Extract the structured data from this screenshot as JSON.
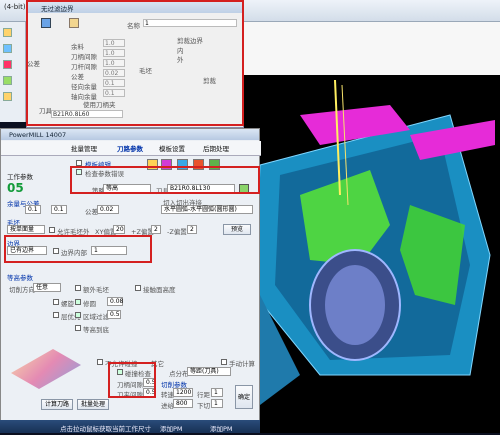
{
  "topbar": {
    "title": "(4-bit)"
  },
  "dialog_top": {
    "title": "无过滤边界",
    "name_label": "名称",
    "name_value": "1",
    "clip_label": "剪裁边界",
    "radio_inside": "内",
    "radio_outside": "外",
    "shape_label": "毛坯",
    "group_label": "公差",
    "fields": [
      {
        "label": "余料",
        "value": "1.0"
      },
      {
        "label": "刀柄间隙",
        "value": "1.0"
      },
      {
        "label": "刀杆间隙",
        "value": "1.0"
      },
      {
        "label": "公差",
        "value": "0.02"
      },
      {
        "label": "径向余量",
        "value": "0.1"
      },
      {
        "label": "轴向余量",
        "value": "0.1"
      }
    ],
    "use_holder": "使用刀柄夹",
    "tool_label": "刀具",
    "tool_value": "B21R0.8L60",
    "clip_btn": "剪裁"
  },
  "dialog_main": {
    "title": "PowerMILL 14007",
    "tabs": [
      "批量管理",
      "刀路参数",
      "模板设置",
      "后期处理"
    ],
    "checks": [
      "模板编辑",
      "检查参数错误"
    ],
    "num": "05",
    "work_param": "工作参数",
    "strategy_label": "策略",
    "strategy_value": "等高",
    "tool_label": "刀具",
    "tool_value": "B21R0.8L130",
    "allowance_label": "余量与公差",
    "allow1": "0.1",
    "allow2": "0.1",
    "tol_label": "公差",
    "tol_value": "0.02",
    "blank_label": "毛坯",
    "blank_value": "按单面量",
    "allowance_check": "允许毛坯外",
    "xy_label": "XY偏置",
    "xy_value": "20",
    "z_plus": "+Z偏置",
    "z_plus_val": "2",
    "z_minus": "-Z偏置",
    "z_minus_val": "2",
    "predict_btn": "预览",
    "inout_label": "切入切出连接",
    "inout_value": "水平圆弧-水平圆弧(圆形圆)",
    "boundary_label": "边界",
    "boundary_value": "已有边界",
    "boundary_check": "边界内部",
    "boundary_sel": "1",
    "contour_label": "等高参数",
    "cut_dir_label": "切削方向",
    "cut_dir_value": "任意",
    "extra_blank": "额外毛坯",
    "contact_corner": "接触面高度",
    "spiral": "螺旋",
    "trim": "修圆",
    "trim_val": "0.08",
    "step_priority": "层优先",
    "area_filter": "区域过滤",
    "area_val": "0.5",
    "recover": "等高到底",
    "no_collision": "不允许碰撞",
    "other": "其它",
    "manual": "手动计算",
    "collision_check": "碰撞检查",
    "tool_gap_label": "刀柄间隙",
    "tool_gap": "0.5",
    "holder_gap_label": "刀夹间隙",
    "holder_gap": "0.5",
    "cut_params": "切削参数",
    "speed_label": "转速",
    "speed": "1200",
    "feed_label": "进给",
    "feed": "800",
    "rows_label": "行距",
    "rows": "1",
    "depth_label": "下切",
    "depth": "1",
    "points_label": "点分布",
    "points_value": "等距(刀具)",
    "calc_btn": "计算刀路",
    "batch_btn": "批量处理",
    "apply_btn": "确定"
  },
  "taskbar": {
    "items": [
      "点击拉动鼠标获取当前工作尺寸",
      "添加PM",
      "添加PM"
    ]
  },
  "colors": {
    "red": "#d42020",
    "yellow": "#fff27a",
    "teal": "#0077aa"
  }
}
